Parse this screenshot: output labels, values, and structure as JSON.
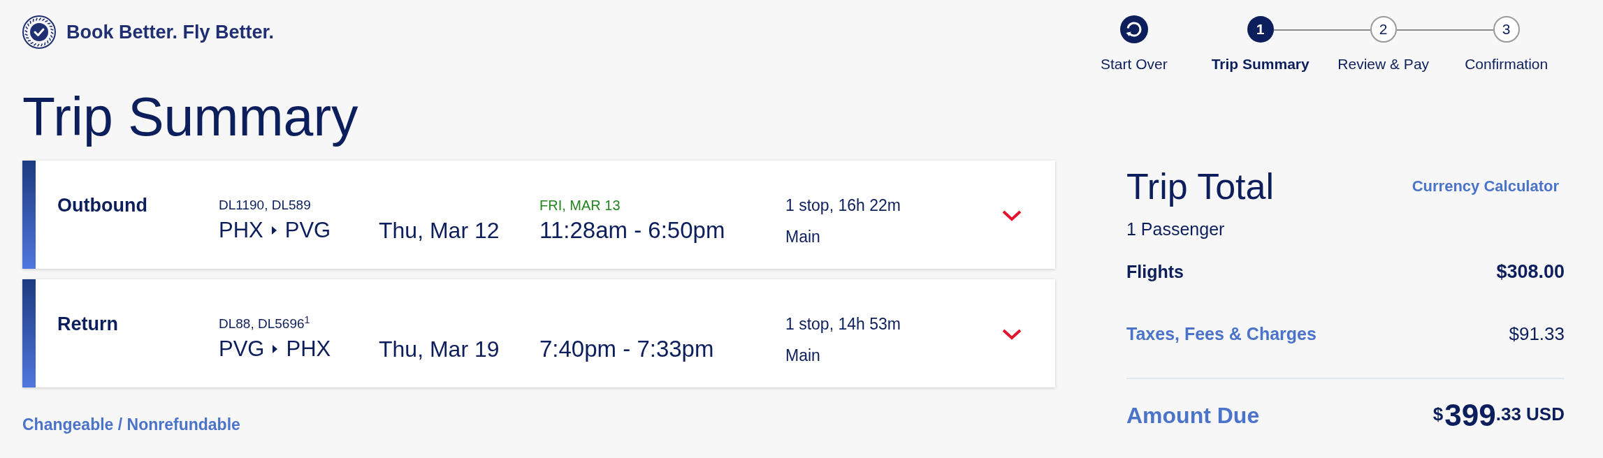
{
  "header": {
    "logo_text": "Book Better. Fly Better."
  },
  "stepper": {
    "start_over": "Start Over",
    "steps": [
      {
        "number": "1",
        "label": "Trip Summary",
        "selected": true
      },
      {
        "number": "2",
        "label": "Review & Pay",
        "selected": false
      },
      {
        "number": "3",
        "label": "Confirmation",
        "selected": false
      }
    ]
  },
  "page_title": "Trip Summary",
  "flights": [
    {
      "direction": "Outbound",
      "flight_numbers": "DL1190, DL589",
      "origin": "PHX",
      "destination": "PVG",
      "date": "Thu, Mar 12",
      "arrival_date_note": "FRI, MAR 13",
      "times": "11:28am - 6:50pm",
      "stops": "1 stop, 16h 22m",
      "cabin": "Main",
      "expanded": false
    },
    {
      "direction": "Return",
      "flight_numbers": "DL88, DL5696$^{1}$",
      "origin": "PVG",
      "destination": "PHX",
      "date": "Thu, Mar 19",
      "times": "7:40pm - 7:33pm",
      "stops": "1 stop, 14h 53m",
      "cabin": "Main",
      "expanded": false
    }
  ],
  "fare_rules_link": "Changeable / Nonrefundable",
  "trip_total": {
    "title": "Trip Total",
    "currency_calculator_link": "Currency Calculator",
    "passengers": "1 Passenger",
    "lines": [
      {
        "kind": "plain",
        "label": "Flights",
        "amount": "$308.00"
      },
      {
        "kind": "link",
        "label": "Taxes, Fees & Charges",
        "amount": "$91.33"
      }
    ],
    "amount_due": {
      "label": "Amount Due",
      "currency_symbol": "$",
      "whole": "399",
      "cents": ".33",
      "currency_code": "USD"
    }
  }
}
